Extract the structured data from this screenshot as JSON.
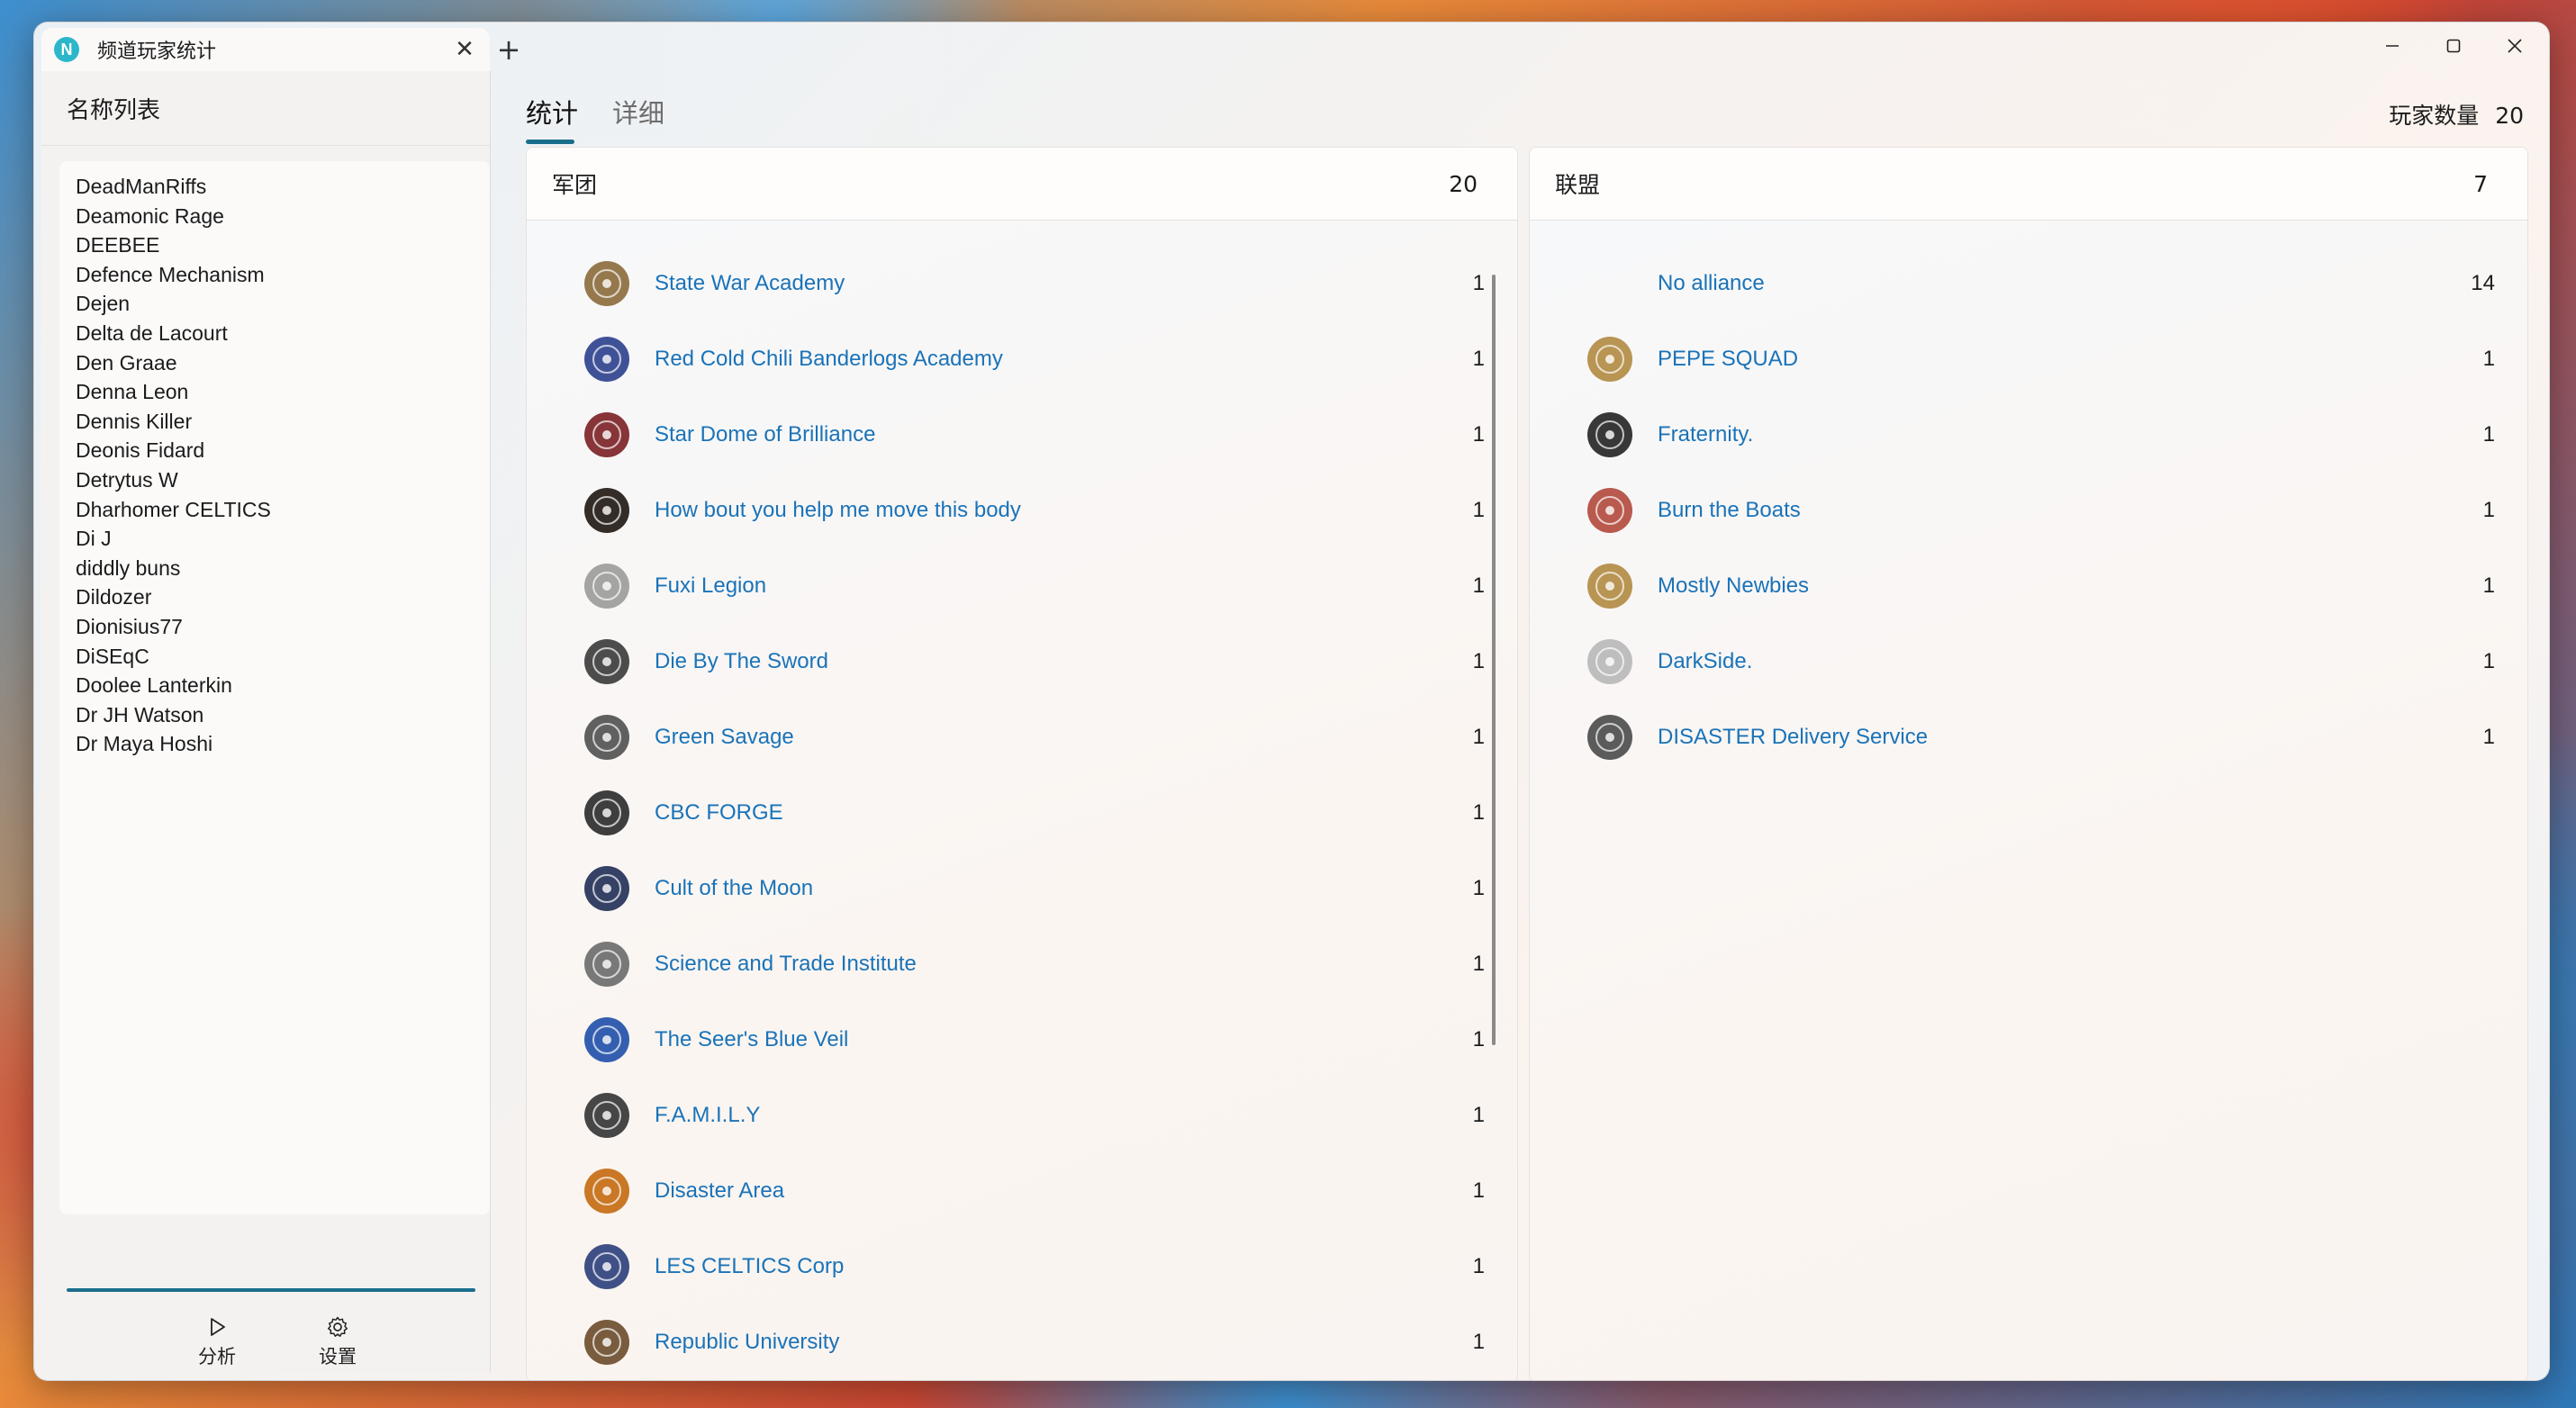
{
  "window": {
    "tab_title": "频道玩家统计",
    "app_icon_letter": "N",
    "accent": "#1a6e8c"
  },
  "sidebar": {
    "title": "名称列表",
    "names": [
      "DeadManRiffs",
      "Deamonic Rage",
      "DEEBEE",
      "Defence Mechanism",
      "Dejen",
      "Delta de Lacourt",
      "Den Graae",
      "Denna Leon",
      "Dennis Killer",
      "Deonis Fidard",
      "Detrytus W",
      "Dharhomer CELTICS",
      "Di J",
      "diddly buns",
      "Dildozer",
      "Dionisius77",
      "DiSEqC",
      "Doolee Lanterkin",
      "Dr JH Watson",
      "Dr Maya Hoshi"
    ],
    "nav": [
      {
        "label": "分析",
        "icon": "play-icon"
      },
      {
        "label": "设置",
        "icon": "gear-icon"
      }
    ]
  },
  "main": {
    "tabs": [
      {
        "label": "统计",
        "active": true
      },
      {
        "label": "详细",
        "active": false
      }
    ],
    "player_count_label": "玩家数量",
    "player_count": "20",
    "corporations": {
      "title": "军团",
      "count": "20",
      "rows": [
        {
          "name": "State War Academy",
          "count": "1",
          "color": "#8a6a3a",
          "icon": "winged-emblem-icon"
        },
        {
          "name": "Red Cold Chili Banderlogs Academy",
          "count": "1",
          "color": "#2b3f8c",
          "icon": "shield-emblem-icon"
        },
        {
          "name": "Star Dome of Brilliance",
          "count": "1",
          "color": "#7a1f22",
          "icon": "circle-emblem-icon"
        },
        {
          "name": "How bout you help me move this body",
          "count": "1",
          "color": "#1d1510",
          "icon": "dark-square-emblem-icon"
        },
        {
          "name": "Fuxi Legion",
          "count": "1",
          "color": "#9a9a9a",
          "icon": "creature-emblem-icon"
        },
        {
          "name": "Die By The Sword",
          "count": "1",
          "color": "#3a3a3a",
          "icon": "eagle-emblem-icon"
        },
        {
          "name": "Green Savage",
          "count": "1",
          "color": "#505050",
          "icon": "phoenix-emblem-icon"
        },
        {
          "name": "CBC FORGE",
          "count": "1",
          "color": "#2a2a2a",
          "icon": "forge-emblem-icon"
        },
        {
          "name": "Cult of the Moon",
          "count": "1",
          "color": "#1f2f55",
          "icon": "moon-emblem-icon"
        },
        {
          "name": "Science and Trade Institute",
          "count": "1",
          "color": "#6a6a6a",
          "icon": "institute-emblem-icon"
        },
        {
          "name": "The Seer's Blue Veil",
          "count": "1",
          "color": "#1e4fa8",
          "icon": "bird-emblem-icon"
        },
        {
          "name": "F.A.M.I.L.Y",
          "count": "1",
          "color": "#333333",
          "icon": "spiky-emblem-icon"
        },
        {
          "name": "Disaster Area",
          "count": "1",
          "color": "#c46a10",
          "icon": "orange-circle-emblem-icon"
        },
        {
          "name": "LES CELTICS Corp",
          "count": "1",
          "color": "#2a3e7a",
          "icon": "cross-emblem-icon"
        },
        {
          "name": "Republic University",
          "count": "1",
          "color": "#6a4a2a",
          "icon": "figure-emblem-icon"
        }
      ]
    },
    "alliances": {
      "title": "联盟",
      "count": "7",
      "rows": [
        {
          "name": "No alliance",
          "count": "14",
          "color": "",
          "icon": ""
        },
        {
          "name": "PEPE SQUAD",
          "count": "1",
          "color": "#b08a40",
          "icon": "star-emblem-icon"
        },
        {
          "name": "Fraternity.",
          "count": "1",
          "color": "#222222",
          "icon": "skull-emblem-icon"
        },
        {
          "name": "Burn the Boats",
          "count": "1",
          "color": "#b0483a",
          "icon": "boat-emblem-icon"
        },
        {
          "name": "Mostly Newbies",
          "count": "1",
          "color": "#b08a40",
          "icon": "star-emblem-icon"
        },
        {
          "name": "DarkSide.",
          "count": "1",
          "color": "#b8b8b8",
          "icon": "grey-circle-emblem-icon"
        },
        {
          "name": "DISASTER Delivery Service",
          "count": "1",
          "color": "#4a4a4a",
          "icon": "disaster-emblem-icon"
        }
      ]
    }
  }
}
